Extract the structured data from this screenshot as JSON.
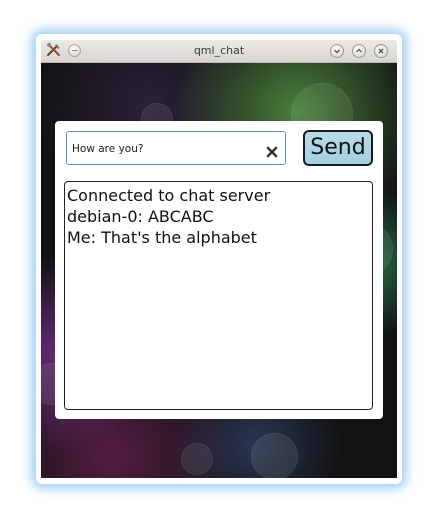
{
  "window": {
    "title": "qml_chat"
  },
  "composer": {
    "message_value": "How are you?",
    "send_label": "Send"
  },
  "chat_log": {
    "lines": [
      "Connected to chat server",
      "debian-0: ABCABC",
      "Me: That's the alphabet"
    ]
  },
  "colors": {
    "send_button_bg": "#a4cfe0",
    "input_border": "#5d8fc9",
    "window_glow": "#5aaaeb"
  },
  "icons": {
    "app": "tools-icon",
    "menu": "window-menu-icon",
    "minimize": "minimize-icon",
    "maximize": "maximize-icon",
    "close": "close-icon",
    "clear": "clear-text-icon"
  }
}
